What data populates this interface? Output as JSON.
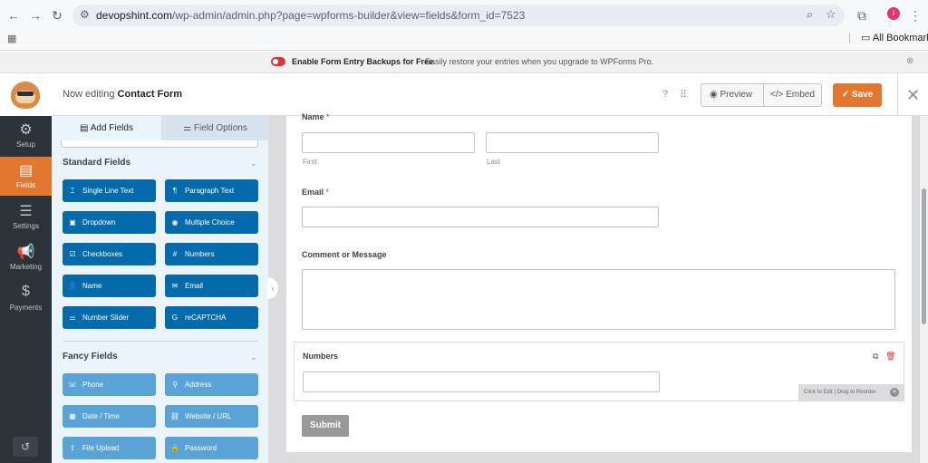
{
  "browser": {
    "url_host": "devopshint.com",
    "url_path": "/wp-admin/admin.php?page=wpforms-builder&view=fields&form_id=7523",
    "profile_initial": "I",
    "all_bookmarks": "All Bookmarks"
  },
  "banner": {
    "title": "Enable Form Entry Backups for Free",
    "text": "Easily restore your entries when you upgrade to WPForms Pro."
  },
  "header": {
    "now_editing": "Now editing",
    "form_name": "Contact Form",
    "preview": "Preview",
    "embed": "Embed",
    "save": "Save"
  },
  "leftnav": [
    {
      "label": "Setup",
      "icon": "gear-icon"
    },
    {
      "label": "Fields",
      "icon": "fields-icon",
      "active": true
    },
    {
      "label": "Settings",
      "icon": "sliders-icon"
    },
    {
      "label": "Marketing",
      "icon": "megaphone-icon"
    },
    {
      "label": "Payments",
      "icon": "dollar-icon"
    }
  ],
  "panel": {
    "tab_add_fields": "Add Fields",
    "tab_field_options": "Field Options",
    "standard_title": "Standard Fields",
    "fancy_title": "Fancy Fields",
    "standard_fields": [
      {
        "label": "Single Line Text",
        "icon": "text-cursor-icon"
      },
      {
        "label": "Paragraph Text",
        "icon": "paragraph-icon"
      },
      {
        "label": "Dropdown",
        "icon": "dropdown-icon"
      },
      {
        "label": "Multiple Choice",
        "icon": "radio-icon"
      },
      {
        "label": "Checkboxes",
        "icon": "checkbox-icon"
      },
      {
        "label": "Numbers",
        "icon": "hash-icon"
      },
      {
        "label": "Name",
        "icon": "user-icon"
      },
      {
        "label": "Email",
        "icon": "envelope-icon"
      },
      {
        "label": "Number Slider",
        "icon": "slider-icon"
      },
      {
        "label": "reCAPTCHA",
        "icon": "google-icon"
      }
    ],
    "fancy_fields": [
      {
        "label": "Phone",
        "icon": "phone-icon"
      },
      {
        "label": "Address",
        "icon": "map-pin-icon"
      },
      {
        "label": "Date / Time",
        "icon": "calendar-icon"
      },
      {
        "label": "Website / URL",
        "icon": "link-icon"
      },
      {
        "label": "File Upload",
        "icon": "upload-icon"
      },
      {
        "label": "Password",
        "icon": "lock-icon"
      }
    ]
  },
  "form": {
    "name_label": "Name",
    "first": "First",
    "last": "Last",
    "email_label": "Email",
    "comment_label": "Comment or Message",
    "numbers_label": "Numbers",
    "required_mark": "*",
    "edit_hint": "Click to Edit | Drag to Reorder",
    "submit": "Submit"
  },
  "colors": {
    "accent": "#e27730",
    "field_button": "#036aab",
    "fancy_button": "#5aa3d6",
    "nav_bg": "#2c3338",
    "panel_bg": "#ebf3fb"
  }
}
